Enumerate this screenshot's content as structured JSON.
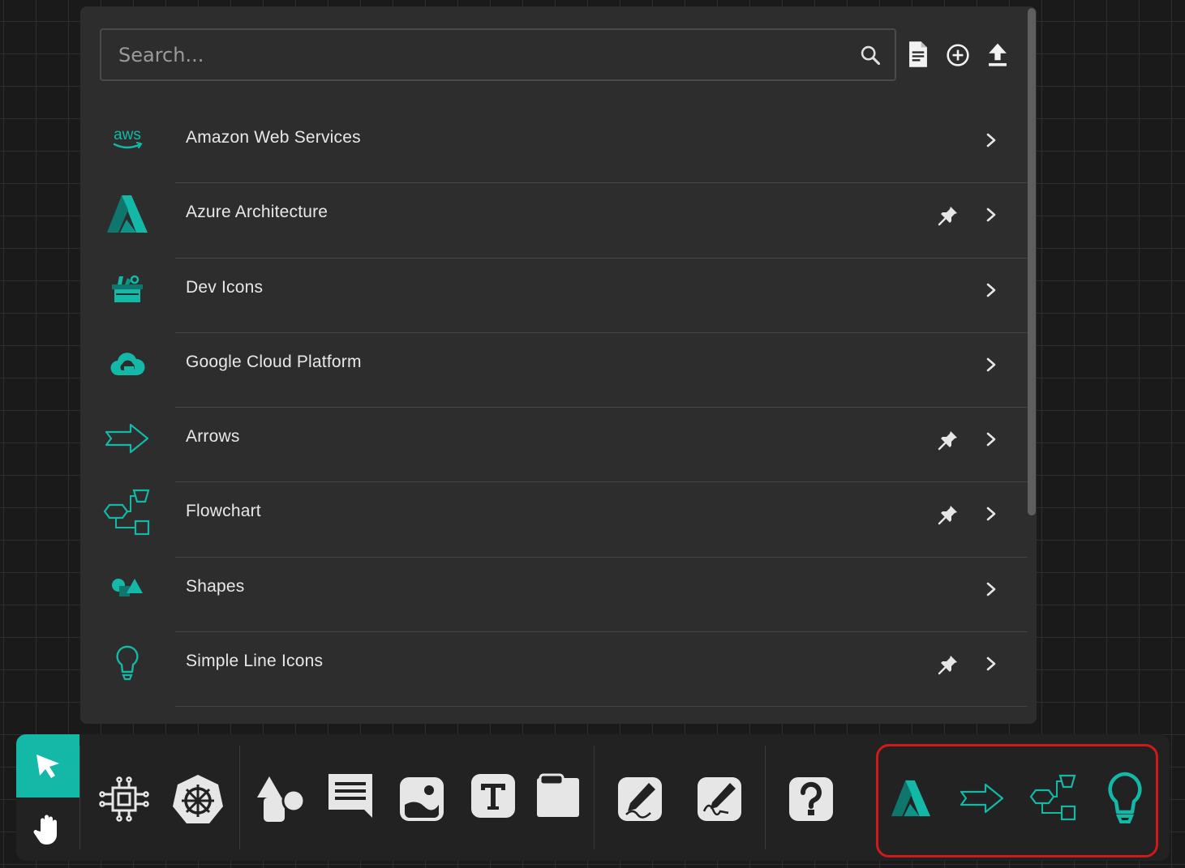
{
  "search": {
    "placeholder": "Search..."
  },
  "header_actions": [
    {
      "icon": "document-icon"
    },
    {
      "icon": "add-circle-icon"
    },
    {
      "icon": "upload-icon"
    }
  ],
  "libraries": [
    {
      "label": "Amazon Web Services",
      "icon": "aws-logo-icon",
      "logo_text": "aws",
      "pinned": false
    },
    {
      "label": "Azure Architecture",
      "icon": "azure-logo-icon",
      "pinned": true
    },
    {
      "label": "Dev Icons",
      "icon": "toolbox-icon",
      "pinned": false
    },
    {
      "label": "Google Cloud Platform",
      "icon": "gcp-cloud-icon",
      "pinned": false
    },
    {
      "label": "Arrows",
      "icon": "arrow-icon",
      "pinned": true
    },
    {
      "label": "Flowchart",
      "icon": "flowchart-icon",
      "pinned": true
    },
    {
      "label": "Shapes",
      "icon": "shapes-icon",
      "pinned": false
    },
    {
      "label": "Simple Line Icons",
      "icon": "lightbulb-icon",
      "pinned": true
    }
  ],
  "toolbar": {
    "tools": [
      "select-pointer-icon",
      "hand-pan-icon",
      "circuit-chip-icon",
      "kubernetes-wheel-icon",
      "shapes-tool-icon",
      "comment-icon",
      "image-icon",
      "text-icon",
      "frame-icon",
      "pen-draw-icon",
      "pencil-sign-icon",
      "help-icon"
    ],
    "pinned_shortcuts": [
      "azure-logo-icon",
      "arrow-icon",
      "flowchart-icon",
      "lightbulb-icon"
    ],
    "active_tool": "select-pointer-icon"
  },
  "colors": {
    "accent": "#14b8a6",
    "panel": "#2d2d2d",
    "highlight": "#d01a1a"
  }
}
